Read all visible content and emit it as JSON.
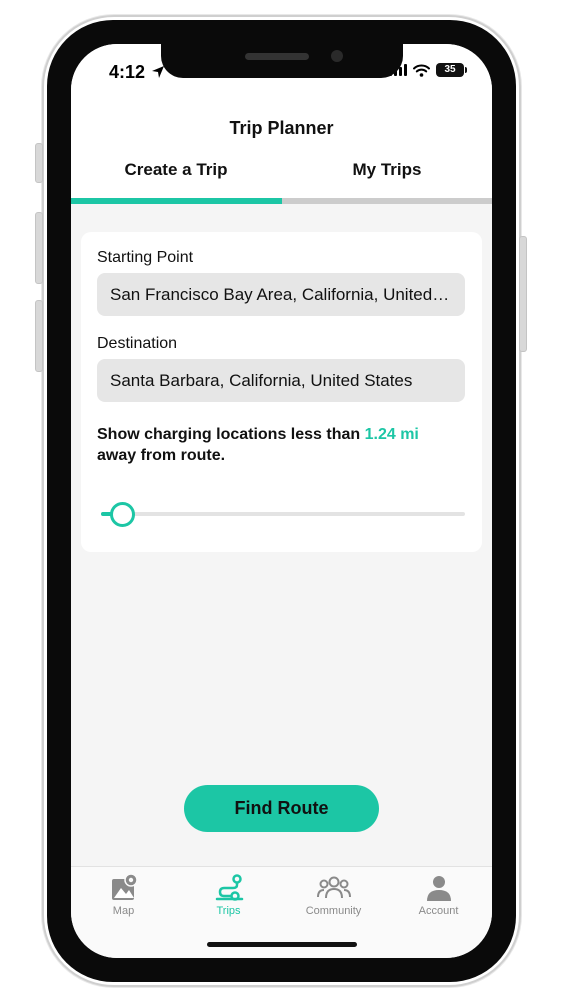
{
  "status_bar": {
    "time": "4:12",
    "battery": "35"
  },
  "header": {
    "title": "Trip Planner",
    "tabs": [
      {
        "label": "Create a Trip",
        "active": true
      },
      {
        "label": "My Trips",
        "active": false
      }
    ]
  },
  "form": {
    "start_label": "Starting Point",
    "start_value": "San Francisco Bay Area, California, United States",
    "destination_label": "Destination",
    "destination_value": "Santa Barbara, California, United States",
    "charging_prefix": "Show charging locations less than ",
    "charging_distance": "1.24 mi",
    "charging_suffix": " away from route.",
    "slider_fraction": 0.06
  },
  "find_route_label": "Find Route",
  "bottom_nav": {
    "items": [
      {
        "label": "Map",
        "icon": "map-icon",
        "active": false
      },
      {
        "label": "Trips",
        "icon": "route-icon",
        "active": true
      },
      {
        "label": "Community",
        "icon": "community-icon",
        "active": false
      },
      {
        "label": "Account",
        "icon": "account-icon",
        "active": false
      }
    ]
  },
  "colors": {
    "accent": "#1cc6a5",
    "inactive_tab_bar": "#cccccc",
    "input_bg": "#e6e6e6",
    "nav_inactive": "#8a8a8a"
  }
}
